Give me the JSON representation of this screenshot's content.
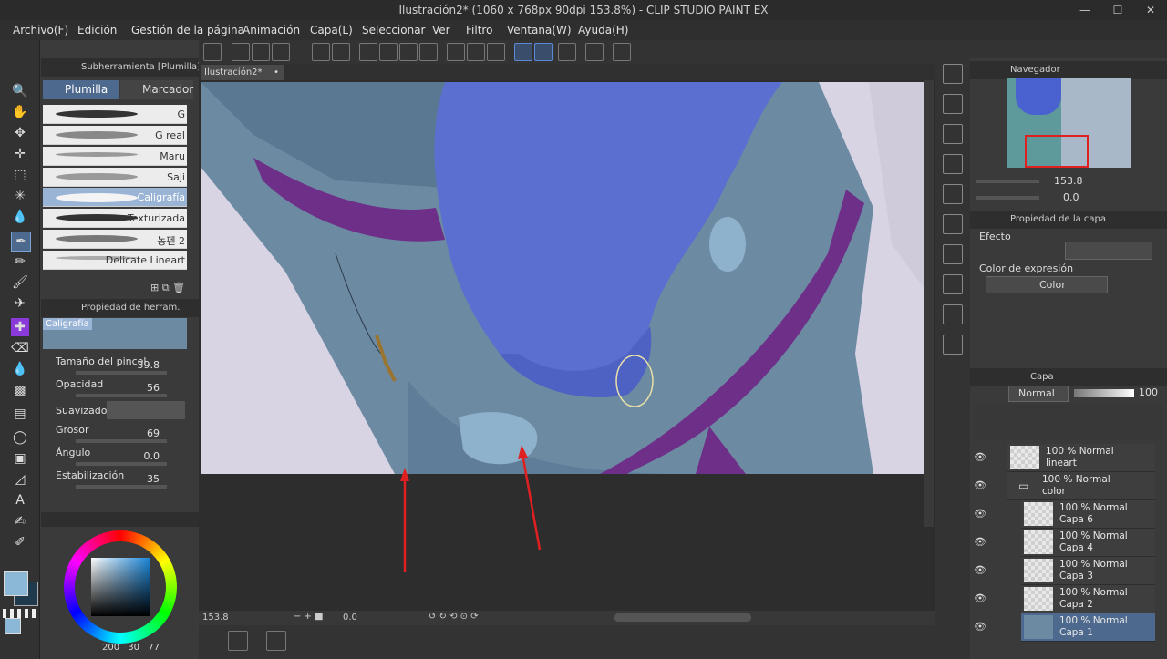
{
  "window": {
    "title": "Ilustración2* (1060 x 768px 90dpi 153.8%)  - CLIP STUDIO PAINT EX",
    "minimize": "—",
    "maximize": "☐",
    "close": "✕"
  },
  "menu": [
    "Archivo(F)",
    "Edición",
    "Gestión de la página",
    "Animación",
    "Capa(L)",
    "Seleccionar",
    "Ver",
    "Filtro",
    "Ventana(W)",
    "Ayuda(H)"
  ],
  "subtool": {
    "header": "Subherramienta [Plumilla]",
    "tabs": [
      "Plumilla",
      "Marcador"
    ],
    "brushes": [
      "G",
      "G real",
      "Maru",
      "Saji",
      "Caligrafía",
      "Texturizada",
      "농펜 2",
      "Delicate Lineart"
    ]
  },
  "tool_property": {
    "header": "Propiedad de herram.",
    "preset_name": "Caligrafía",
    "rows": [
      {
        "label": "Tamaño del pincel",
        "value": "39.8"
      },
      {
        "label": "Opacidad",
        "value": "56"
      },
      {
        "label": "Suavizado",
        "value": ""
      },
      {
        "label": "Grosor",
        "value": "69"
      },
      {
        "label": "Ángulo",
        "value": "0.0"
      },
      {
        "label": "Estabilización",
        "value": "35"
      }
    ]
  },
  "color_panel": {
    "main_color": "#8cb8d8",
    "sub_color": "#1f3a4d",
    "values": [
      "200",
      "30",
      "77"
    ]
  },
  "canvas": {
    "tab_label": "Ilustración2*",
    "tab_close": "•",
    "zoom": "153.8",
    "rotation": "0.0"
  },
  "navigator": {
    "header": "Navegador",
    "zoom": "153.8",
    "rotation": "0.0"
  },
  "layer_property": {
    "header": "Propiedad de la capa",
    "effect_label": "Efecto",
    "expression_label": "Color de expresión",
    "expression_value": "Color"
  },
  "layer_panel": {
    "header": "Capa",
    "blend_mode": "Normal",
    "opacity": "100",
    "layers": [
      {
        "line1": "100 % Normal",
        "line2": "lineart",
        "indent": false,
        "folder": false,
        "selected": false
      },
      {
        "line1": "100 % Normal",
        "line2": "color",
        "indent": false,
        "folder": true,
        "selected": false
      },
      {
        "line1": "100 % Normal",
        "line2": "Capa 6",
        "indent": true,
        "folder": false,
        "selected": false
      },
      {
        "line1": "100 % Normal",
        "line2": "Capa 4",
        "indent": true,
        "folder": false,
        "selected": false
      },
      {
        "line1": "100 % Normal",
        "line2": "Capa 3",
        "indent": true,
        "folder": false,
        "selected": false
      },
      {
        "line1": "100 % Normal",
        "line2": "Capa 2",
        "indent": true,
        "folder": false,
        "selected": false
      },
      {
        "line1": "100 % Normal",
        "line2": "Capa 1",
        "indent": true,
        "folder": false,
        "selected": true
      }
    ]
  },
  "icons": {
    "tools": [
      "zoom-icon",
      "hand-icon",
      "move-layer-icon",
      "move-icon",
      "selection-icon",
      "magic-wand-icon",
      "eyedropper-icon",
      "pen-icon",
      "pencil-icon",
      "brush-icon",
      "airbrush-icon",
      "decoration-icon",
      "eraser-icon",
      "blend-icon",
      "fill-icon",
      "gradient-icon",
      "figure-icon",
      "frame-icon",
      "ruler-icon",
      "text-icon",
      "balloon-icon",
      "correct-line-icon"
    ],
    "tool_glyphs": [
      "🔍",
      "✋",
      "✥",
      "✛",
      "⬚",
      "✳",
      "💧",
      "✒",
      "✏",
      "🖌",
      "✈",
      "✚",
      "⌫",
      "💧",
      "▩",
      "▤",
      "◯",
      "▣",
      "◿",
      "A",
      "✍",
      "✐"
    ]
  }
}
